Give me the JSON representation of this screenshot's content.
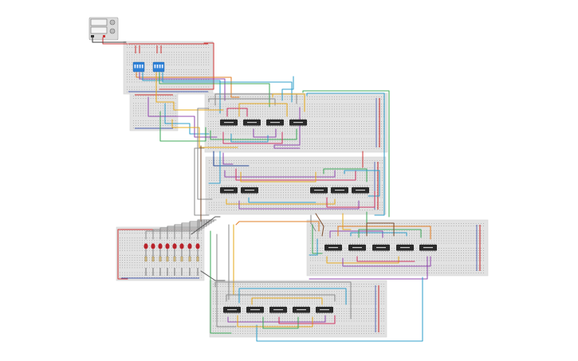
{
  "colors": {
    "board": "#e2e2e2",
    "chip": "#2a2a2a",
    "rail_positive": "#cc3333",
    "rail_negative": "#4a5fb0",
    "led": "#b8222a",
    "dip_switch": "#2b7fd6",
    "wire_palette": [
      "#e6a817",
      "#2a9cc9",
      "#8e44ad",
      "#cf2f5e",
      "#3aa655",
      "#7a4a2a",
      "#8a8a8a",
      "#1a3f8f",
      "#e07a1f"
    ]
  },
  "components": {
    "power_supply": {
      "icon": "bench-power-supply-icon"
    },
    "input_board": {
      "dip_switch_count": 2
    },
    "chip_board_1": {
      "chip_count": 4
    },
    "chip_board_2": {
      "chip_count": 5
    },
    "chip_board_3": {
      "chip_count": 5
    },
    "chip_board_4": {
      "chip_count": 5
    },
    "led_board": {
      "led_count": 8
    }
  }
}
